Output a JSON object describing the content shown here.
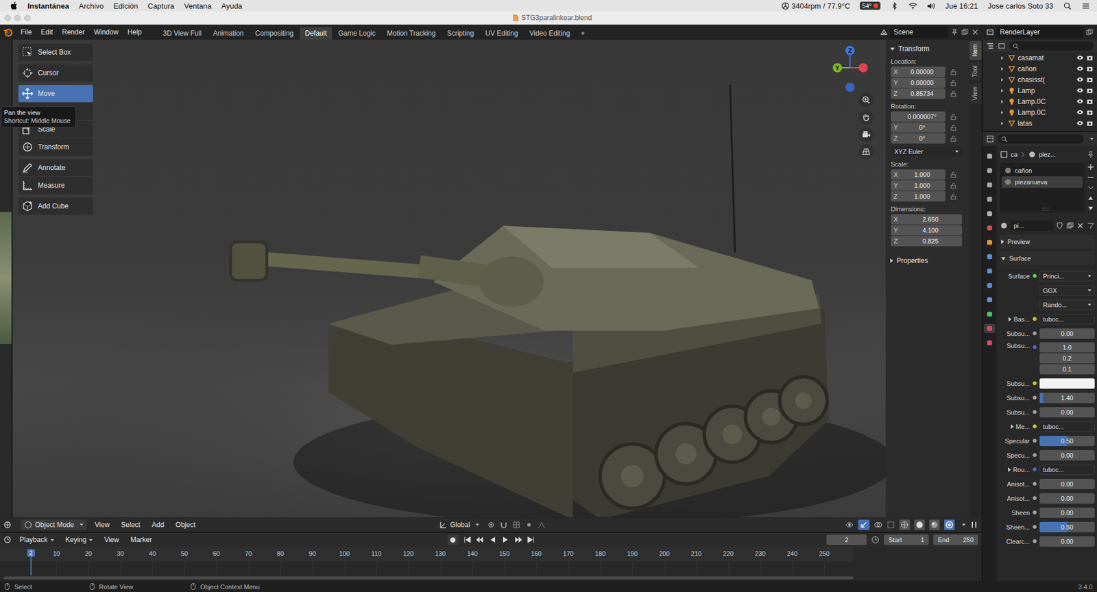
{
  "mac_menubar": {
    "app": "Instantánea",
    "menus": [
      "Archivo",
      "Edición",
      "Captura",
      "Ventana",
      "Ayuda"
    ],
    "fan": "3404rpm / 77.9°C",
    "cpu_badge": "54°",
    "clock": "Jue 16:21",
    "user": "Jose carlos Soto 33"
  },
  "window": {
    "title": "STG3paralinkear.blend"
  },
  "topbar": {
    "menus": [
      "File",
      "Edit",
      "Render",
      "Window",
      "Help"
    ],
    "workspaces": [
      {
        "label": "3D View Full",
        "selected": false
      },
      {
        "label": "Animation",
        "selected": false
      },
      {
        "label": "Compositing",
        "selected": false
      },
      {
        "label": "Default",
        "selected": true
      },
      {
        "label": "Game Logic",
        "selected": false
      },
      {
        "label": "Motion Tracking",
        "selected": false
      },
      {
        "label": "Scripting",
        "selected": false
      },
      {
        "label": "UV Editing",
        "selected": false
      },
      {
        "label": "Video Editing",
        "selected": false
      }
    ],
    "add_tab": "+",
    "scene": "Scene",
    "view_layer": "RenderLayer"
  },
  "toolbar": {
    "groups": [
      [
        {
          "label": "Select Box",
          "selected": false,
          "icon": "select"
        }
      ],
      [
        {
          "label": "Cursor",
          "selected": false,
          "icon": "cursor"
        }
      ],
      [
        {
          "label": "Move",
          "selected": true,
          "icon": "move"
        },
        {
          "label": "",
          "selected": false,
          "icon": "rotate"
        },
        {
          "label": "Scale",
          "selected": false,
          "icon": "scale"
        },
        {
          "label": "Transform",
          "selected": false,
          "icon": "transform"
        }
      ],
      [
        {
          "label": "Annotate",
          "selected": false,
          "icon": "annotate"
        },
        {
          "label": "Measure",
          "selected": false,
          "icon": "measure"
        }
      ],
      [
        {
          "label": "Add Cube",
          "selected": false,
          "icon": "cube"
        }
      ]
    ]
  },
  "tooltip": {
    "title": "Pan the view",
    "shortcut": "Shortcut: Middle Mouse"
  },
  "gizmo": {
    "axes": [
      {
        "label": "Z",
        "color": "#3b78e0"
      },
      {
        "label": "Y",
        "color": "#82b825"
      },
      {
        "label": "",
        "color": "#e2444f"
      },
      {
        "label": "",
        "color": "#3567c4"
      }
    ]
  },
  "npanel": {
    "tabs": [
      {
        "label": "Item",
        "selected": true
      },
      {
        "label": "Tool",
        "selected": false
      },
      {
        "label": "View",
        "selected": false
      }
    ],
    "title": "Transform",
    "expanded": true,
    "sections": [
      {
        "kind": "fields",
        "label": "Location:",
        "fields": [
          {
            "axis": "X",
            "value": "0.00000",
            "locked": false
          },
          {
            "axis": "Y",
            "value": "0.00000",
            "locked": false
          },
          {
            "axis": "Z",
            "value": "0.85734",
            "locked": false
          }
        ]
      },
      {
        "kind": "fields",
        "label": "Rotation:",
        "fields": [
          {
            "axis": "",
            "value": "0.000007°",
            "locked": false
          },
          {
            "axis": "Y",
            "value": "0°",
            "locked": false
          },
          {
            "axis": "Z",
            "value": "0°",
            "locked": false
          }
        ]
      },
      {
        "kind": "dropdown",
        "label": "",
        "value": "XYZ Euler"
      },
      {
        "kind": "fields",
        "label": "Scale:",
        "fields": [
          {
            "axis": "X",
            "value": "1.000",
            "locked": false
          },
          {
            "axis": "Y",
            "value": "1.000",
            "locked": false
          },
          {
            "axis": "Z",
            "value": "1.000",
            "locked": false
          }
        ]
      },
      {
        "kind": "fields",
        "label": "Dimensions:",
        "fields": [
          {
            "axis": "X",
            "value": "2.650"
          },
          {
            "axis": "Y",
            "value": "4.100"
          },
          {
            "axis": "Z",
            "value": "0.825"
          }
        ]
      }
    ],
    "subpanel": {
      "label": "Properties",
      "expanded": false
    }
  },
  "viewport_header": {
    "mode": "Object Mode",
    "menus": [
      "View",
      "Select",
      "Add",
      "Object"
    ],
    "orientation": "Global"
  },
  "timeline": {
    "menus": [
      {
        "label": "Playback",
        "dropdown": true
      },
      {
        "label": "Keying",
        "dropdown": true
      },
      {
        "label": "View",
        "dropdown": false
      },
      {
        "label": "Marker",
        "dropdown": false
      }
    ],
    "current_frame": "2",
    "start_label": "Start",
    "start": "1",
    "end_label": "End",
    "end": "250",
    "playhead": "2",
    "ticks": [
      "10",
      "20",
      "30",
      "40",
      "50",
      "60",
      "70",
      "80",
      "90",
      "100",
      "110",
      "120",
      "130",
      "140",
      "150",
      "160",
      "170",
      "180",
      "190",
      "200",
      "210",
      "220",
      "230",
      "240",
      "250"
    ]
  },
  "outliner": {
    "items": [
      {
        "name": "casamat",
        "kind": "mesh",
        "visible": true,
        "renderable": true
      },
      {
        "name": "cañon",
        "kind": "mesh",
        "visible": true,
        "renderable": true
      },
      {
        "name": "chasisst(",
        "kind": "mesh",
        "visible": true,
        "renderable": true
      },
      {
        "name": "Lamp",
        "kind": "light",
        "visible": true,
        "renderable": true
      },
      {
        "name": "Lamp.0C",
        "kind": "light",
        "visible": true,
        "renderable": true
      },
      {
        "name": "Lamp.0C",
        "kind": "light",
        "visible": true,
        "renderable": true
      },
      {
        "name": "latas",
        "kind": "mesh",
        "visible": true,
        "renderable": true
      }
    ]
  },
  "properties": {
    "tabs": [
      {
        "name": "tool",
        "color": "#b0b0b0",
        "selected": false
      },
      {
        "name": "render",
        "color": "#a8a8a8",
        "selected": false
      },
      {
        "name": "output",
        "color": "#a8a8a8",
        "selected": false
      },
      {
        "name": "view-layer",
        "color": "#a8a8a8",
        "selected": false
      },
      {
        "name": "scene",
        "color": "#b0b0b0",
        "selected": false
      },
      {
        "name": "world",
        "color": "#d0544f",
        "selected": false
      },
      {
        "name": "object",
        "color": "#e8963a",
        "selected": false
      },
      {
        "name": "modifiers",
        "color": "#5d8fd6",
        "selected": false
      },
      {
        "name": "particles",
        "color": "#5d8fd6",
        "selected": false
      },
      {
        "name": "physics",
        "color": "#5d8fd6",
        "selected": false
      },
      {
        "name": "constraints",
        "color": "#6b8fcf",
        "selected": false
      },
      {
        "name": "data",
        "color": "#4fbf6a",
        "selected": false
      },
      {
        "name": "material",
        "color": "#d84f6a",
        "selected": true
      },
      {
        "name": "texture",
        "color": "#d84f6a",
        "selected": false
      }
    ],
    "breadcrumb": [
      "ca",
      "piez..."
    ],
    "slots": [
      {
        "name": "cañon",
        "selected": false
      },
      {
        "name": "piezanueva",
        "selected": true
      }
    ],
    "material": "pi...",
    "panels": [
      {
        "label": "Preview",
        "expanded": false
      },
      {
        "label": "Surface",
        "expanded": true
      }
    ],
    "rows": [
      {
        "kind": "enum",
        "label": "Surface",
        "value": "Princi...",
        "socket": "#5fcf5f"
      },
      {
        "kind": "enum",
        "label": "",
        "value": "GGX"
      },
      {
        "kind": "enum",
        "label": "",
        "value": "Rando..."
      },
      {
        "kind": "link",
        "label": "Bas...",
        "value": "tuboc...",
        "socket": "#c9c53a",
        "expanded": false
      },
      {
        "kind": "number",
        "label": "Subsu...",
        "value": "0.00",
        "level": 0,
        "socket": "#a1a1a1"
      },
      {
        "kind": "vector",
        "label": "Subsu...",
        "values": [
          "1.0",
          "0.2",
          "0.1"
        ],
        "socket": "#6363c7"
      },
      {
        "kind": "color",
        "label": "Subsu...",
        "color": "#f2f2f2",
        "socket": "#c9c53a"
      },
      {
        "kind": "number",
        "label": "Subsu...",
        "value": "1.40",
        "level": 0.06,
        "socket": "#a1a1a1"
      },
      {
        "kind": "number",
        "label": "Subsu...",
        "value": "0.00",
        "level": 0,
        "socket": "#a1a1a1"
      },
      {
        "kind": "link",
        "label": "Me...",
        "value": "tuboc...",
        "socket": "#c9c53a",
        "expanded": false
      },
      {
        "kind": "number",
        "label": "Specular",
        "value": "0.50",
        "level": 0.5,
        "socket": "#a1a1a1"
      },
      {
        "kind": "number",
        "label": "Specu...",
        "value": "0.00",
        "level": 0,
        "socket": "#a1a1a1"
      },
      {
        "kind": "link",
        "label": "Rou...",
        "value": "tuboc...",
        "socket": "#6363c7",
        "expanded": false
      },
      {
        "kind": "number",
        "label": "Anisot...",
        "value": "0.00",
        "level": 0,
        "socket": "#a1a1a1"
      },
      {
        "kind": "number",
        "label": "Anisot...",
        "value": "0.00",
        "level": 0,
        "socket": "#a1a1a1"
      },
      {
        "kind": "number",
        "label": "Sheen",
        "value": "0.00",
        "level": 0,
        "socket": "#a1a1a1"
      },
      {
        "kind": "number",
        "label": "Sheen...",
        "value": "0.50",
        "level": 0.5,
        "socket": "#a1a1a1"
      },
      {
        "kind": "number",
        "label": "Clearc...",
        "value": "0.00",
        "level": 0,
        "socket": "#a1a1a1"
      }
    ]
  },
  "status_bar": {
    "items": [
      "Select",
      "Rotate View",
      "Object Context Menu"
    ],
    "version": "3.4.0"
  }
}
